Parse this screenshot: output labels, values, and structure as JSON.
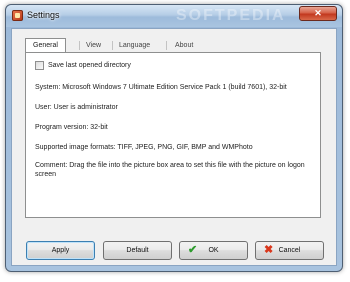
{
  "window": {
    "title": "Settings",
    "watermark": "SOFTPEDIA",
    "close_glyph": "✕"
  },
  "tabs": [
    {
      "label": "General",
      "active": true
    },
    {
      "label": "View",
      "active": false
    },
    {
      "label": "Language",
      "active": false
    },
    {
      "label": "About",
      "active": false
    }
  ],
  "general": {
    "save_last_dir_label": "Save last opened directory",
    "save_last_dir_checked": false,
    "system": "System: Microsoft Windows 7 Ultimate Edition  Service Pack 1 (build 7601), 32-bit",
    "user": "User: User is administrator",
    "program_version": "Program version: 32-bit",
    "formats": "Supported image formats: TIFF, JPEG, PNG, GIF, BMP and WMPhoto",
    "comment": "Comment: Drag the file into the picture box area to set this file with the picture on logon screen"
  },
  "buttons": {
    "apply": "Apply",
    "default": "Default",
    "ok": "OK",
    "cancel": "Cancel",
    "ok_icon_glyph": "✔",
    "cancel_icon_glyph": "✖"
  },
  "colors": {
    "ok_icon": "#2e9c2e",
    "cancel_icon": "#d9371c",
    "close_button": "#c2381f"
  }
}
